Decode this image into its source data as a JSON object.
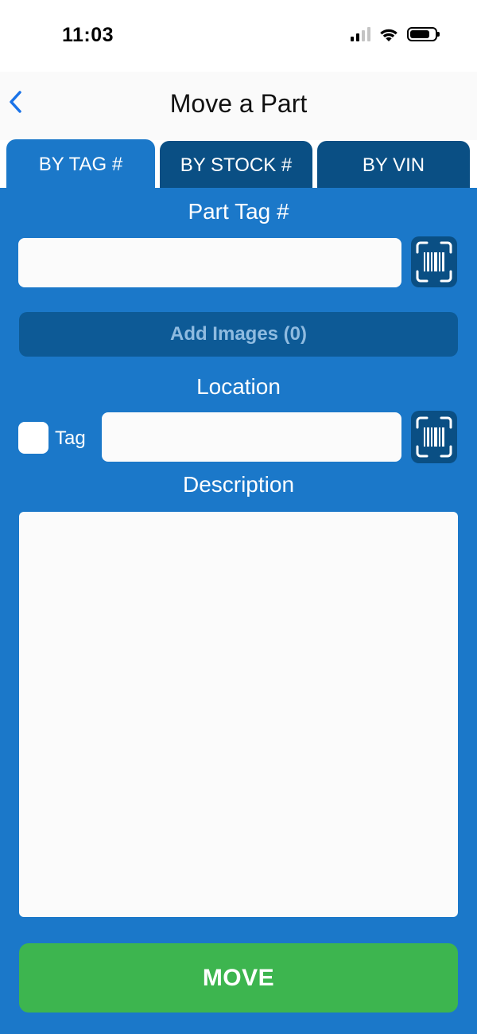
{
  "status_bar": {
    "time": "11:03"
  },
  "nav": {
    "title": "Move a Part",
    "back_icon": "chevron-left-icon"
  },
  "tabs": [
    {
      "label": "BY TAG #",
      "active": true
    },
    {
      "label": "BY STOCK #",
      "active": false
    },
    {
      "label": "BY VIN",
      "active": false
    }
  ],
  "part_tag": {
    "label": "Part Tag #",
    "value": "",
    "scan_icon": "barcode-scan-icon"
  },
  "add_images": {
    "label": "Add Images (0)"
  },
  "location": {
    "label": "Location",
    "checkbox_label": "Tag",
    "value": "",
    "scan_icon": "barcode-scan-icon"
  },
  "description": {
    "label": "Description",
    "value": ""
  },
  "move_button": {
    "label": "MOVE"
  },
  "colors": {
    "panel_blue": "#1b78c9",
    "tab_dark": "#0a4f84",
    "move_green": "#3db54f",
    "back_blue": "#1a73e8"
  }
}
